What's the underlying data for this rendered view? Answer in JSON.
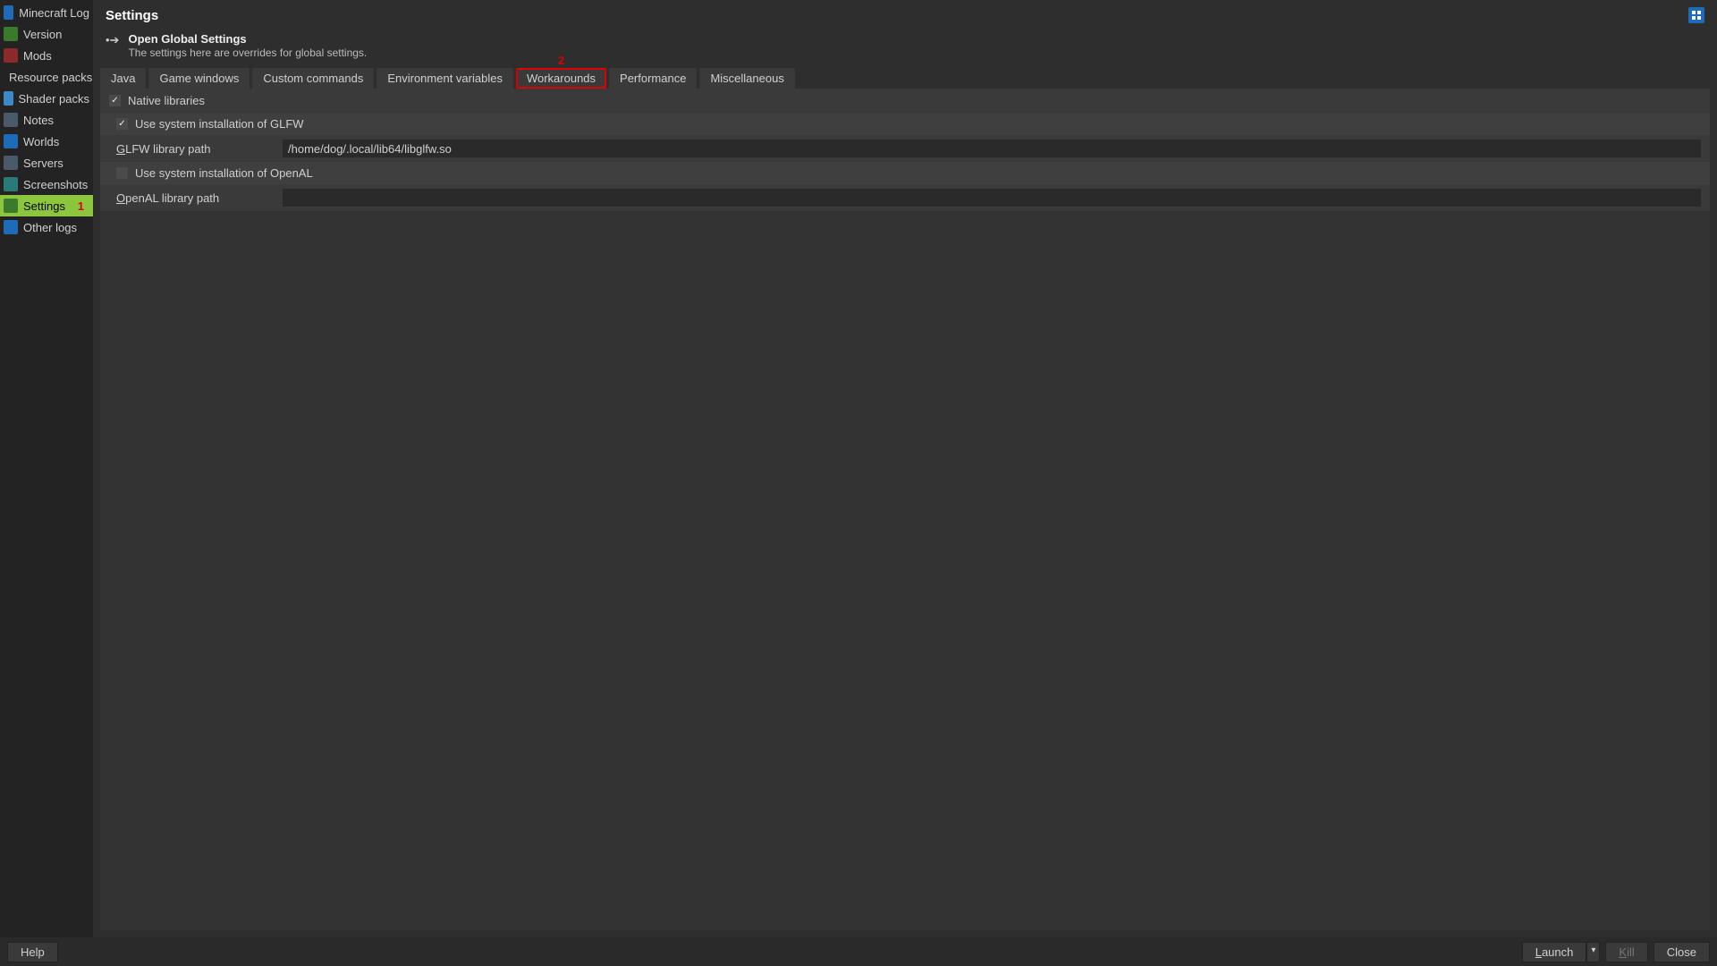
{
  "page_title": "Settings",
  "sidebar": {
    "items": [
      {
        "label": "Minecraft Log",
        "icon": "book-icon",
        "icon_class": "ic-blue"
      },
      {
        "label": "Version",
        "icon": "grass-icon",
        "icon_class": "ic-green"
      },
      {
        "label": "Mods",
        "icon": "star-icon",
        "icon_class": "ic-red"
      },
      {
        "label": "Resource packs",
        "icon": "package-icon",
        "icon_class": "ic-orange"
      },
      {
        "label": "Shader packs",
        "icon": "image-icon",
        "icon_class": "ic-sky"
      },
      {
        "label": "Notes",
        "icon": "notes-icon",
        "icon_class": "ic-steel"
      },
      {
        "label": "Worlds",
        "icon": "world-icon",
        "icon_class": "ic-blue"
      },
      {
        "label": "Servers",
        "icon": "server-icon",
        "icon_class": "ic-steel"
      },
      {
        "label": "Screenshots",
        "icon": "screenshot-icon",
        "icon_class": "ic-teal"
      },
      {
        "label": "Settings",
        "icon": "settings-icon",
        "icon_class": "ic-green",
        "active": true,
        "annotation": "1"
      },
      {
        "label": "Other logs",
        "icon": "logs-icon",
        "icon_class": "ic-blue"
      }
    ]
  },
  "global_link": {
    "title": "Open Global Settings",
    "subtitle": "The settings here are overrides for global settings."
  },
  "tabs": [
    {
      "label": "Java"
    },
    {
      "label": "Game windows"
    },
    {
      "label": "Custom commands"
    },
    {
      "label": "Environment variables"
    },
    {
      "label": "Workarounds",
      "highlighted": true,
      "annotation": "2"
    },
    {
      "label": "Performance"
    },
    {
      "label": "Miscellaneous"
    }
  ],
  "group": {
    "title": "Native libraries",
    "checked": true
  },
  "rows": {
    "glfw_check": {
      "label": "Use system installation of GLFW",
      "checked": true
    },
    "glfw_path": {
      "label_pre": "G",
      "label_rest": "LFW library path",
      "value": "/home/dog/.local/lib64/libglfw.so"
    },
    "openal_check": {
      "label": "Use system installation of OpenAL",
      "checked": false
    },
    "openal_path": {
      "label_pre": "O",
      "label_rest": "penAL library path",
      "value": ""
    }
  },
  "footer": {
    "help": "Help",
    "launch_pre": "L",
    "launch_rest": "aunch",
    "kill_pre": "K",
    "kill_rest": "ill",
    "close": "Close"
  }
}
